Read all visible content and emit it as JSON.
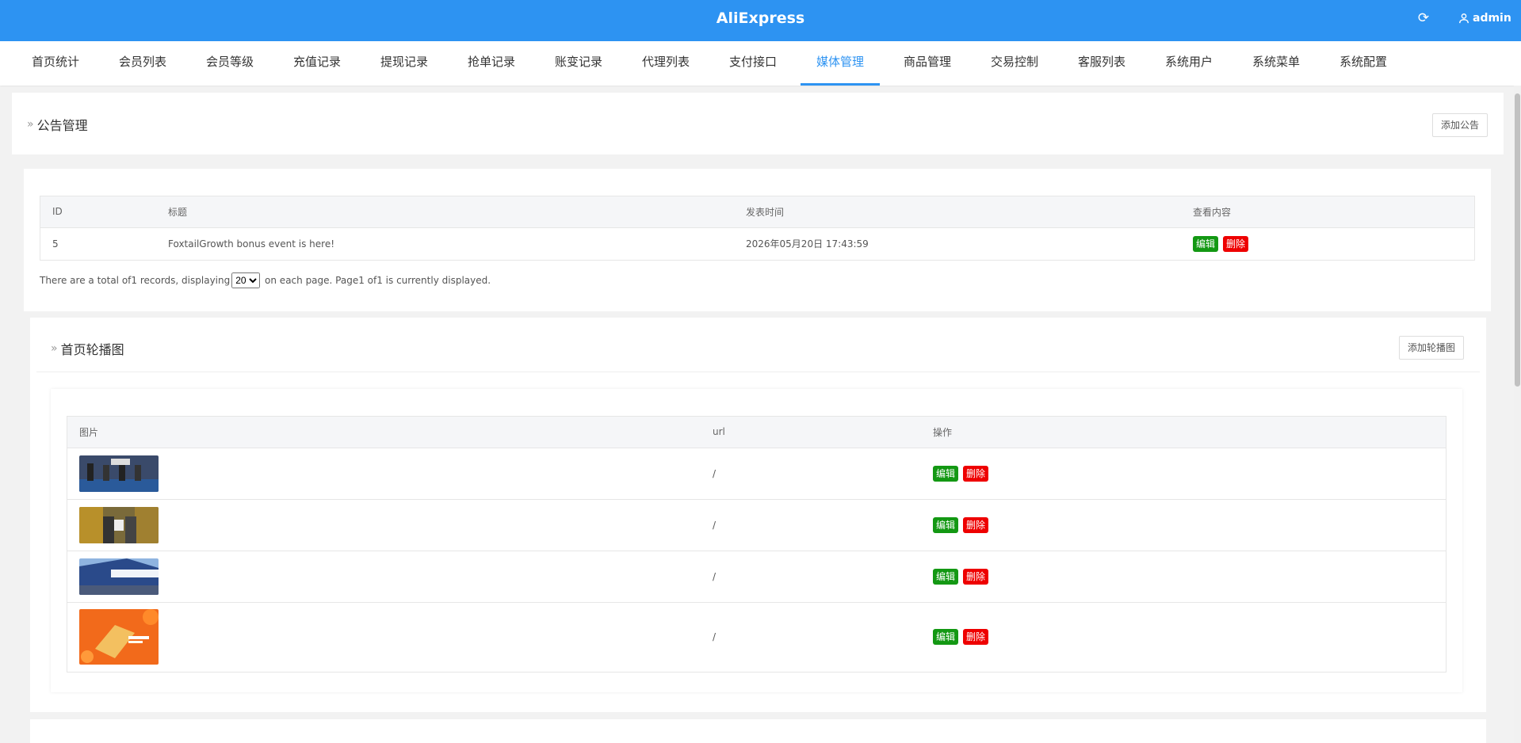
{
  "header": {
    "brand": "AliExpress",
    "user_name": "admin"
  },
  "nav": {
    "items": [
      "首页统计",
      "会员列表",
      "会员等级",
      "充值记录",
      "提现记录",
      "抢单记录",
      "账变记录",
      "代理列表",
      "支付接口",
      "媒体管理",
      "商品管理",
      "交易控制",
      "客服列表",
      "系统用户",
      "系统菜单",
      "系统配置"
    ],
    "active": "媒体管理"
  },
  "announcements": {
    "title": "公告管理",
    "add_label": "添加公告",
    "columns": [
      "ID",
      "标题",
      "发表时间",
      "查看内容"
    ],
    "rows": [
      {
        "id": "5",
        "title": "FoxtailGrowth bonus event is here!",
        "time": "2026年05月20日 17:43:59",
        "edit": "编辑",
        "delete": "删除"
      }
    ],
    "pager": {
      "before": "There are a total of1 records, displaying",
      "per_page": "20",
      "after": " on each page. Page1 of1 is currently displayed."
    }
  },
  "banners": {
    "title": "首页轮播图",
    "add_label": "添加轮播图",
    "columns": [
      "图片",
      "url",
      "操作"
    ],
    "rows": [
      {
        "image": "banner-image-1",
        "url": "/",
        "edit": "编辑",
        "delete": "删除"
      },
      {
        "image": "banner-image-2",
        "url": "/",
        "edit": "编辑",
        "delete": "删除"
      },
      {
        "image": "banner-image-3",
        "url": "/",
        "edit": "编辑",
        "delete": "删除"
      },
      {
        "image": "banner-image-4",
        "url": "/",
        "edit": "编辑",
        "delete": "删除"
      }
    ]
  },
  "colors": {
    "primary": "#2d93f2",
    "edit": "#139813",
    "delete": "#ee0000"
  }
}
